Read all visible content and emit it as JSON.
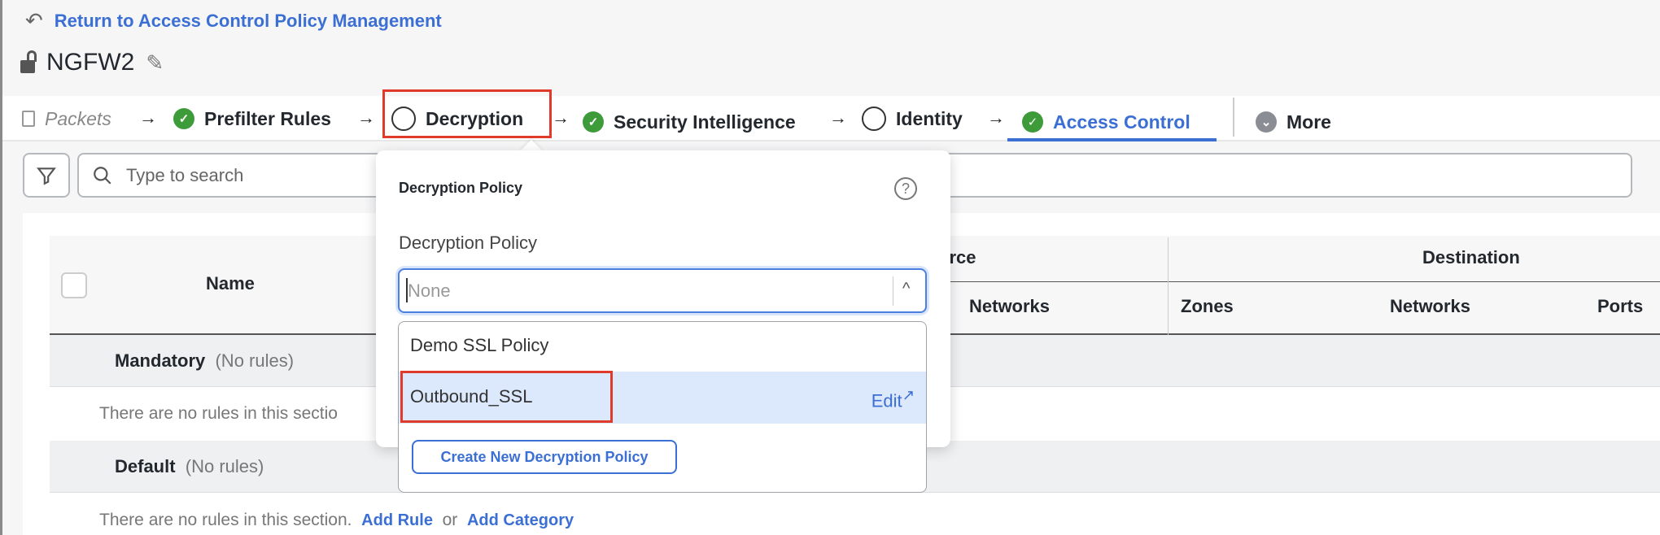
{
  "header": {
    "back_label": "Return to Access Control Policy Management",
    "policy_name": "NGFW2"
  },
  "tabs": [
    {
      "label": "Packets",
      "status": "disabled"
    },
    {
      "label": "Prefilter Rules",
      "status": "complete"
    },
    {
      "label": "Decryption",
      "status": "empty"
    },
    {
      "label": "Security Intelligence",
      "status": "complete"
    },
    {
      "label": "Identity",
      "status": "empty"
    },
    {
      "label": "Access Control",
      "status": "complete",
      "active": true
    },
    {
      "label": "More",
      "status": "menu"
    }
  ],
  "search": {
    "placeholder": "Type to search"
  },
  "table": {
    "headers": {
      "name": "Name",
      "source_partial": "urce",
      "destination": "Destination",
      "source_networks": "Networks",
      "dest_zones": "Zones",
      "dest_networks": "Networks",
      "dest_ports": "Ports"
    },
    "sections": [
      {
        "name": "Mandatory",
        "count": "(No rules)",
        "empty_text": "There are no rules in this sectio"
      },
      {
        "name": "Default",
        "count": "(No rules)",
        "empty_text": "There are no rules in this section.",
        "add_rule": "Add Rule",
        "or": "or",
        "add_category": "Add Category"
      }
    ]
  },
  "popover": {
    "title": "Decryption Policy",
    "field_label": "Decryption Policy",
    "input_placeholder": "None",
    "options": [
      {
        "label": "Demo SSL Policy"
      },
      {
        "label": "Outbound_SSL",
        "highlighted": true,
        "action": "Edit"
      }
    ],
    "create_label": "Create New Decryption Policy"
  },
  "colors": {
    "accent": "#3b6fd4",
    "success": "#3e9b3a",
    "highlight": "#dce8fb",
    "annotation": "#e03a2b"
  }
}
